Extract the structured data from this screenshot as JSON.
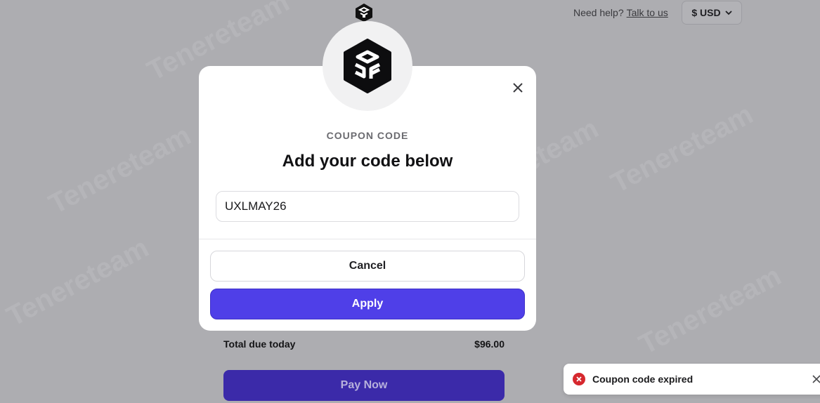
{
  "header": {
    "help_text": "Need help?",
    "help_link": "Talk to us",
    "currency_label": "$ USD",
    "logo_icon": "brand-hexagon-logo"
  },
  "summary": {
    "total_label": "Total due today",
    "total_value": "$96.00",
    "pay_label": "Pay Now"
  },
  "modal": {
    "eyebrow": "COUPON CODE",
    "title": "Add your code below",
    "code_value": "UXLMAY26",
    "cancel_label": "Cancel",
    "apply_label": "Apply",
    "close_icon": "close-icon"
  },
  "toast": {
    "message": "Coupon code expired",
    "status_color": "#d6282e"
  },
  "colors": {
    "accent": "#4f3fe8",
    "overlay": "#adadb1"
  }
}
